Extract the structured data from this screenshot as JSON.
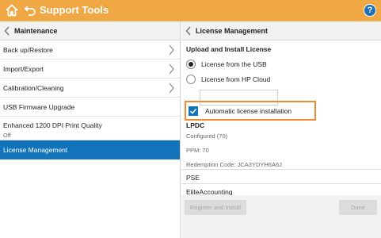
{
  "header": {
    "title": "Support Tools",
    "help": "?",
    "accent": "#f0a845",
    "selection_color": "#1173b9"
  },
  "left_panel": {
    "title": "Maintenance",
    "items": [
      {
        "label": "Back up/Restore",
        "has_arrow": true
      },
      {
        "label": "Import/Export",
        "has_arrow": true
      },
      {
        "label": "Calibration/Cleaning",
        "has_arrow": true
      },
      {
        "label": "USB Firmware Upgrade",
        "has_arrow": false
      },
      {
        "label": "Enhanced 1200 DPI Print Quality",
        "sub": "Off",
        "has_arrow": false
      },
      {
        "label": "License Management",
        "selected": true
      }
    ]
  },
  "right_panel": {
    "title": "License Management",
    "upload_section_title": "Upload and Install License",
    "radio_options": [
      {
        "label": "License from the USB",
        "checked": true
      },
      {
        "label": "License from HP Cloud",
        "checked": false
      }
    ],
    "cloud_input_value": "",
    "auto_install": {
      "label": "Automatic license installation",
      "checked": true
    },
    "lpdc": {
      "heading": "LPDC",
      "status": "Configured (70)",
      "ppm": "PPM: 70",
      "redemption": "Redemption Code: JCA3YDYH6A6J"
    },
    "pse_label": "PSE",
    "eliteaccounting_label": "EliteAccounting",
    "buttons": {
      "register_install": "Register and Install",
      "done": "Done"
    }
  }
}
